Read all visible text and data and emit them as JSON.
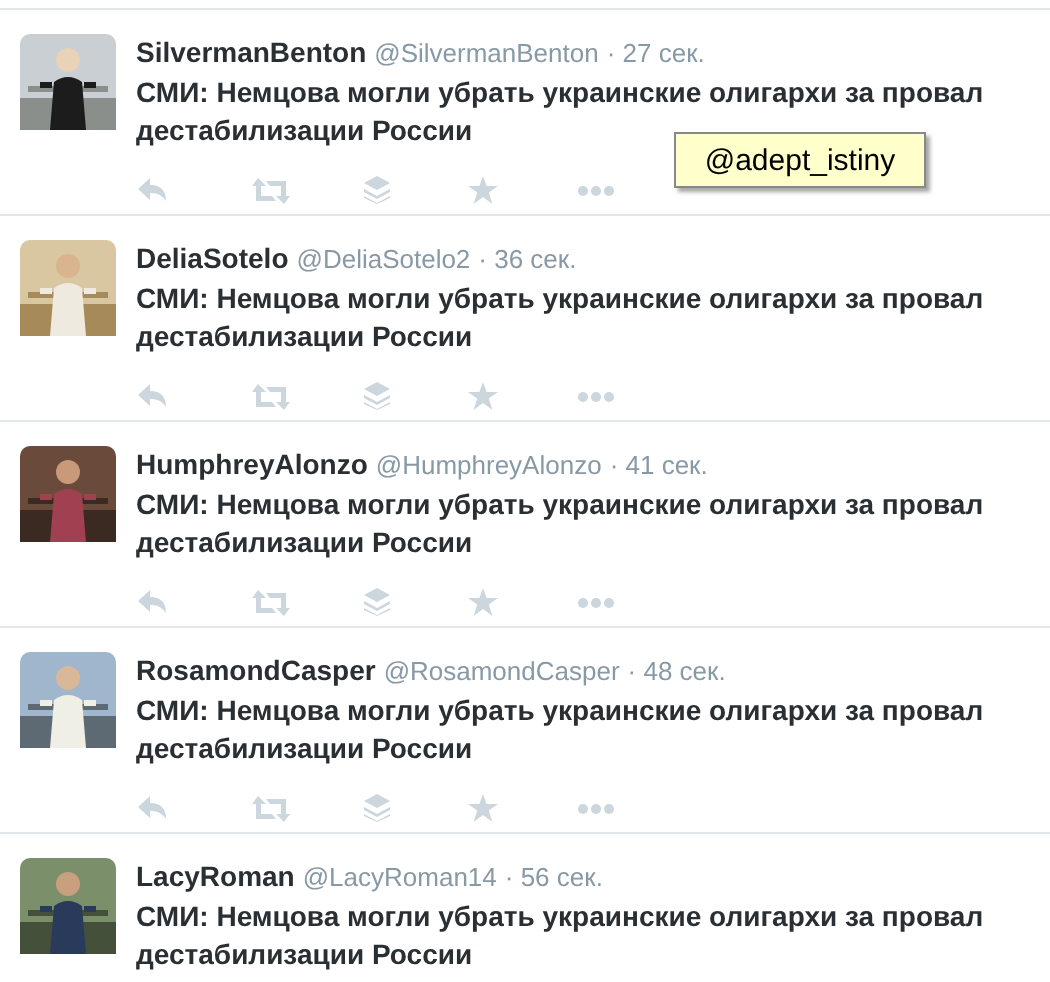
{
  "tweets": [
    {
      "name": "SilvermanBenton",
      "handle": "@SilvermanBenton",
      "time": "· 27 сек.",
      "text": "СМИ: Немцова могли убрать украинские олигархи за провал дестабилизации России"
    },
    {
      "name": "DeliaSotelo",
      "handle": "@DeliaSotelo2",
      "time": "· 36 сек.",
      "text": "СМИ: Немцова могли убрать украинские олигархи за провал дестабилизации России"
    },
    {
      "name": "HumphreyAlonzo",
      "handle": "@HumphreyAlonzo",
      "time": "· 41 сек.",
      "text": "СМИ: Немцова могли убрать украинские олигархи за провал дестабилизации России"
    },
    {
      "name": "RosamondCasper",
      "handle": "@RosamondCasper",
      "time": "· 48 сек.",
      "text": "СМИ: Немцова могли убрать украинские олигархи за провал дестабилизации России"
    },
    {
      "name": "LacyRoman",
      "handle": "@LacyRoman14",
      "time": "· 56 сек.",
      "text": "СМИ: Немцова могли убрать украинские олигархи за провал дестабилизации России"
    }
  ],
  "tooltip": {
    "text": "@adept_istiny"
  }
}
